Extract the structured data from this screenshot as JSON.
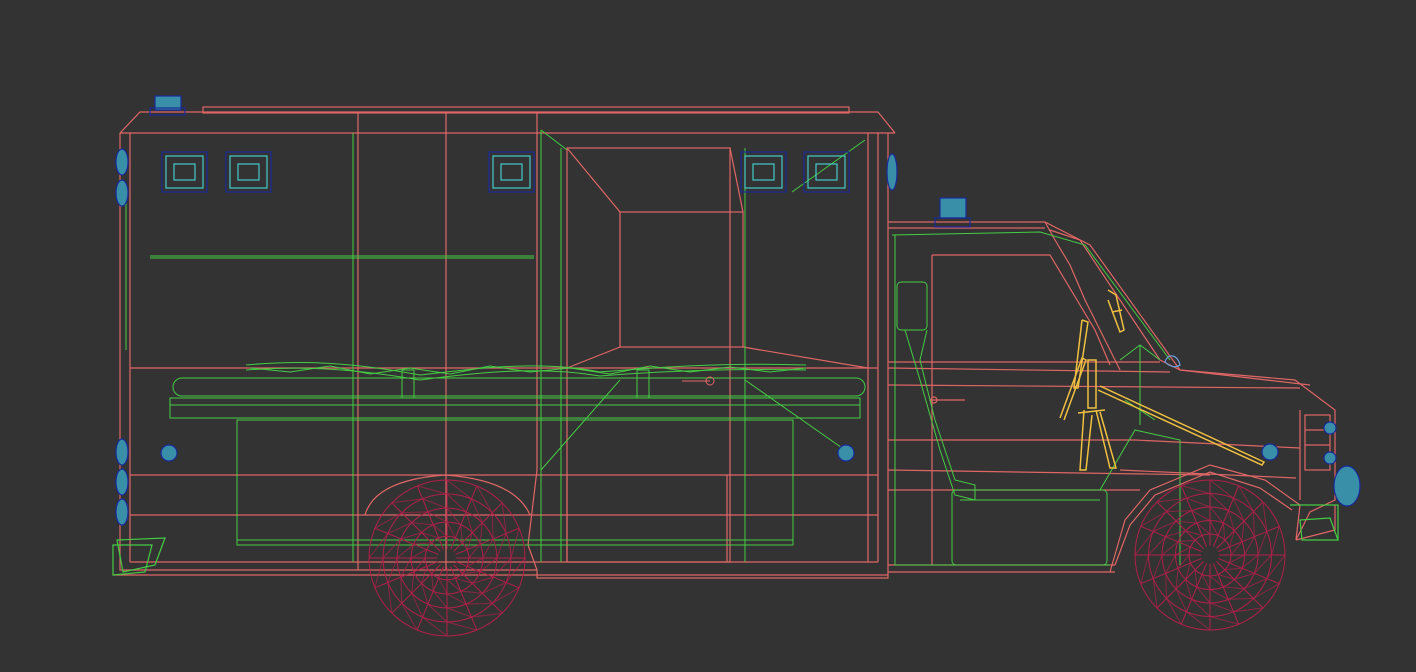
{
  "viewport": {
    "view": "side wireframe",
    "model": "ambulance",
    "background_color": "#333333"
  },
  "colors": {
    "body_wire": "#e06666",
    "interior_wire": "#44cc44",
    "wheel_wire": "#b0204a",
    "light_fill": "#3a8fa8",
    "light_edge": "#1a2a9a",
    "light_inner": "#44cccc",
    "seat_wire": "#f0c040",
    "steering_accent": "#6aa0e0"
  },
  "meshes": [
    {
      "name": "rear-box-body",
      "color_key": "body_wire"
    },
    {
      "name": "cab-body",
      "color_key": "body_wire"
    },
    {
      "name": "front-wheel",
      "color_key": "wheel_wire"
    },
    {
      "name": "rear-wheel",
      "color_key": "wheel_wire"
    },
    {
      "name": "stretcher",
      "color_key": "interior_wire"
    },
    {
      "name": "driver-seat",
      "color_key": "seat_wire"
    },
    {
      "name": "beacon-lights",
      "color_key": "light_fill"
    }
  ]
}
